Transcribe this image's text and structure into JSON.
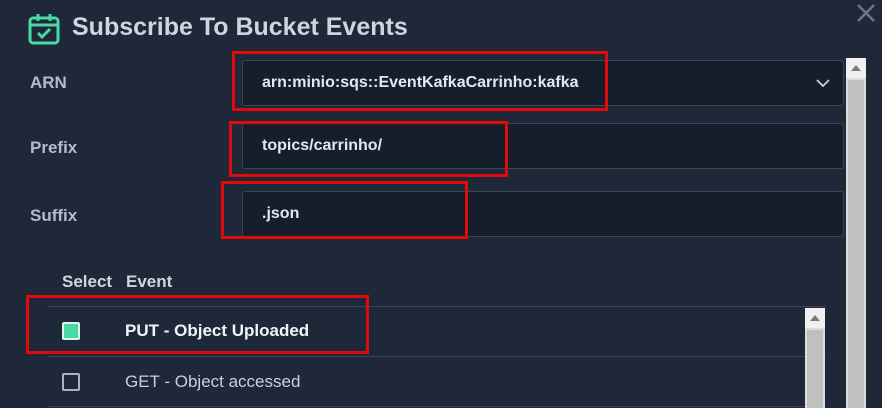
{
  "modal": {
    "title": "Subscribe To Bucket Events",
    "icon": "calendar-check-icon",
    "close_icon": "close-icon"
  },
  "form": {
    "arn": {
      "label": "ARN",
      "value": "arn:minio:sqs::EventKafkaCarrinho:kafka"
    },
    "prefix": {
      "label": "Prefix",
      "value": "topics/carrinho/"
    },
    "suffix": {
      "label": "Suffix",
      "value": ".json"
    }
  },
  "events_table": {
    "headers": {
      "select": "Select",
      "event": "Event"
    },
    "rows": [
      {
        "label": "PUT - Object Uploaded",
        "checked": true
      },
      {
        "label": "GET - Object accessed",
        "checked": false
      }
    ]
  },
  "colors": {
    "background": "#1e2838",
    "field_bg": "#171e2b",
    "highlight": "#e00a0a",
    "checkbox_checked": "#4ad9a3"
  }
}
